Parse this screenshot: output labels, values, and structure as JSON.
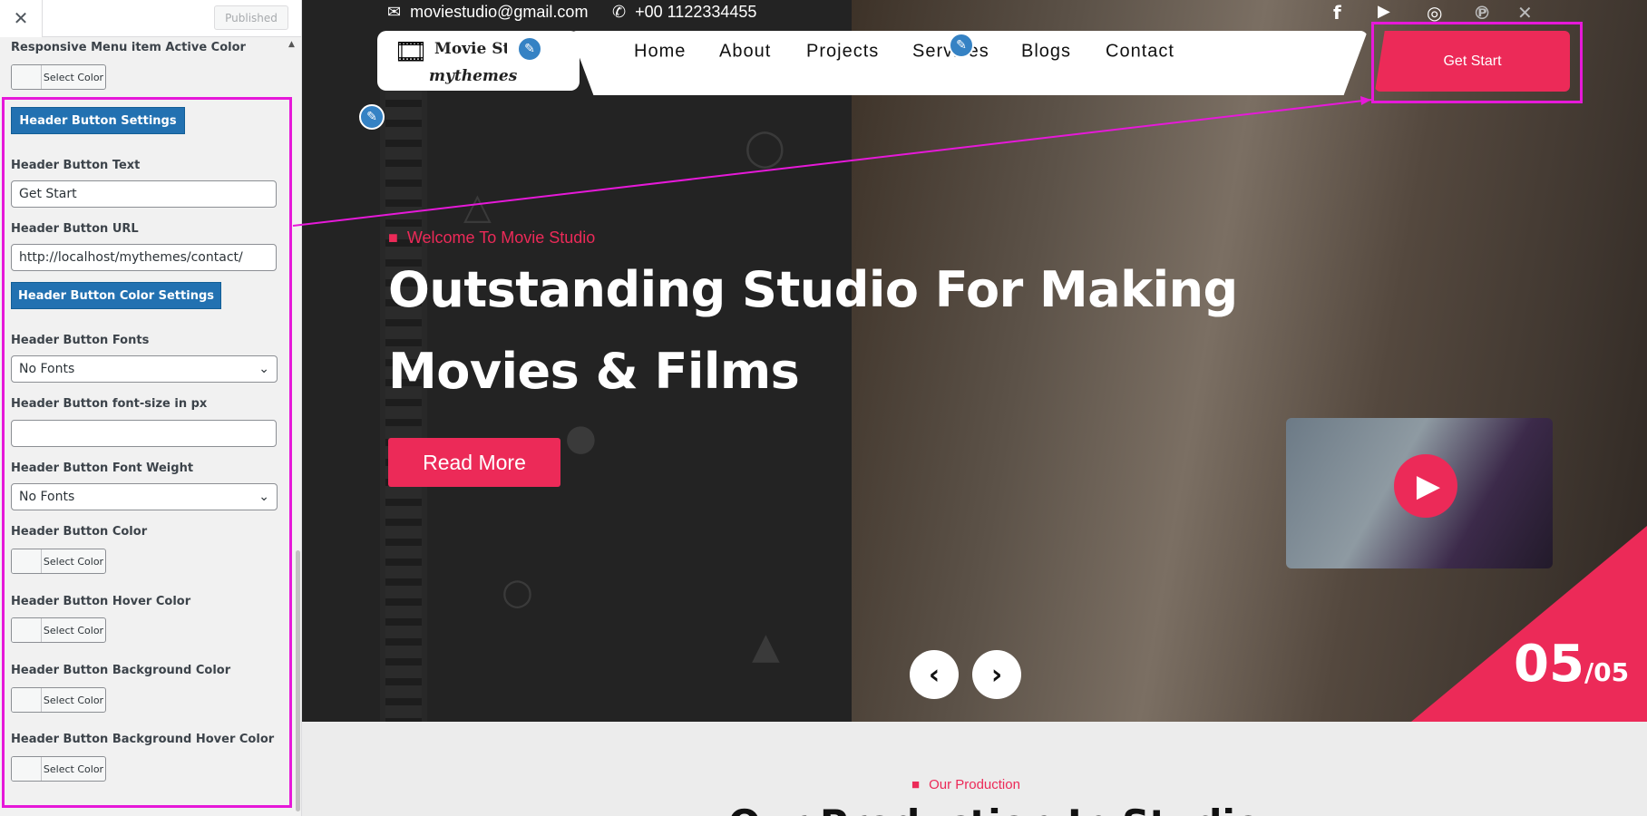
{
  "customizer": {
    "close_icon": "close-icon",
    "published_label": "Published",
    "active_color_label": "Responsive Menu item Active Color",
    "select_color_label": "Select Color",
    "header_button_settings": "Header Button Settings",
    "button_text_label": "Header Button Text",
    "button_text_value": "Get Start",
    "button_url_label": "Header Button URL",
    "button_url_value": "http://localhost/mythemes/contact/",
    "color_settings": "Header Button Color Settings",
    "fonts_label": "Header Button Fonts",
    "fonts_value": "No Fonts",
    "font_size_label": "Header Button font-size in px",
    "font_size_value": "",
    "font_weight_label": "Header Button Font Weight",
    "font_weight_value": "No Fonts",
    "button_color_label": "Header Button Color",
    "hover_color_label": "Header Button Hover Color",
    "bg_color_label": "Header Button Background Color",
    "bg_hover_color_label": "Header Button Background Hover Color"
  },
  "site": {
    "email": "moviestudio@gmail.com",
    "phone": "+00 1122334455",
    "social": [
      "facebook-icon",
      "youtube-icon",
      "instagram-icon",
      "pinterest-icon",
      "x-icon"
    ],
    "logo_title": "Movie Studio",
    "logo_sub": "mythemes",
    "nav": [
      "Home",
      "About",
      "Projects",
      "Services",
      "Blogs",
      "Contact"
    ],
    "cta": "Get Start",
    "welcome": "Welcome To Movie Studio",
    "headline_1": "Outstanding Studio For Making",
    "headline_2": "Movies & Films",
    "read_more": "Read More",
    "slide_current": "05",
    "slide_total": "/05",
    "production_label": "Our Production",
    "production_title": "Our Production In Studio"
  },
  "colors": {
    "accent": "#ec2a58",
    "highlight": "#e619d9",
    "wp_blue": "#2271b1"
  }
}
